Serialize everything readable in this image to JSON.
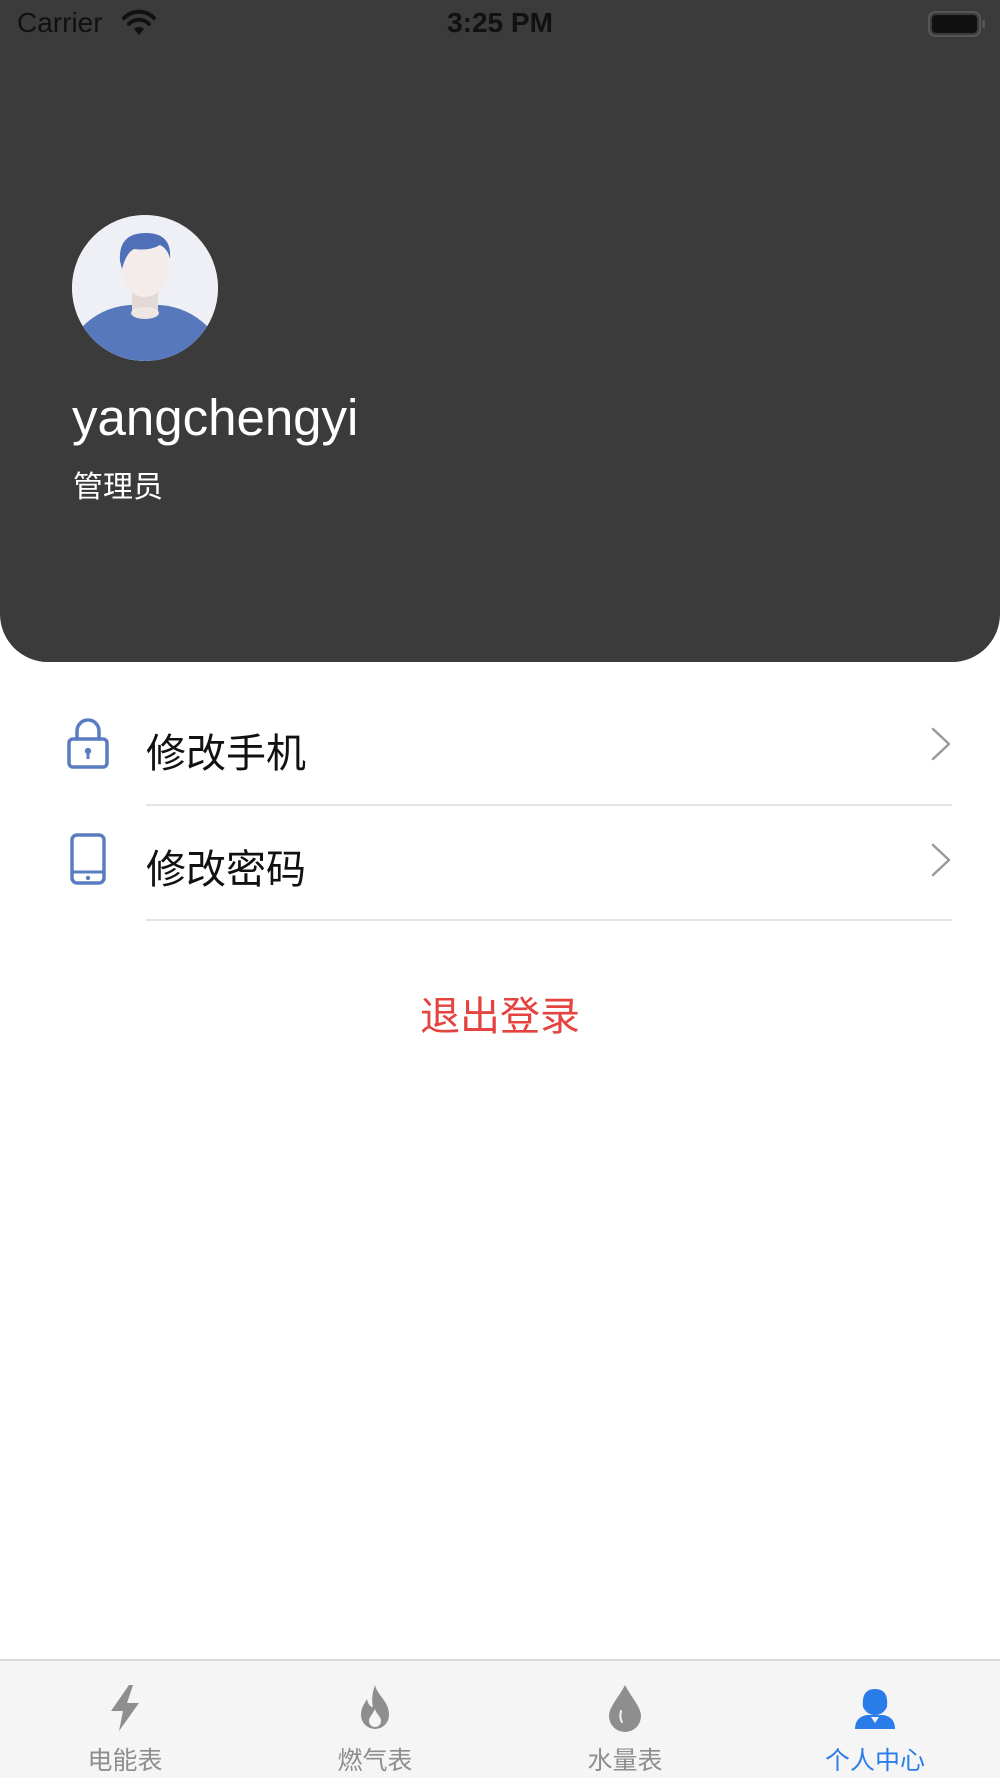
{
  "status_bar": {
    "carrier": "Carrier",
    "time": "3:25 PM"
  },
  "profile": {
    "username": "yangchengyi",
    "role": "管理员"
  },
  "menu": [
    {
      "label": "修改手机",
      "icon": "lock-icon"
    },
    {
      "label": "修改密码",
      "icon": "phone-icon"
    }
  ],
  "logout_label": "退出登录",
  "tabbar": {
    "active_index": 3,
    "items": [
      {
        "label": "电能表",
        "icon": "lightning-icon"
      },
      {
        "label": "燃气表",
        "icon": "flame-icon"
      },
      {
        "label": "水量表",
        "icon": "water-drop-icon"
      },
      {
        "label": "个人中心",
        "icon": "person-icon"
      }
    ]
  },
  "colors": {
    "header_bg": "#3b3b3b",
    "accent": "#2a7de8",
    "icon_blue": "#5a7dc1",
    "logout": "#e5433f",
    "inactive_tab": "#8e8e8e"
  }
}
